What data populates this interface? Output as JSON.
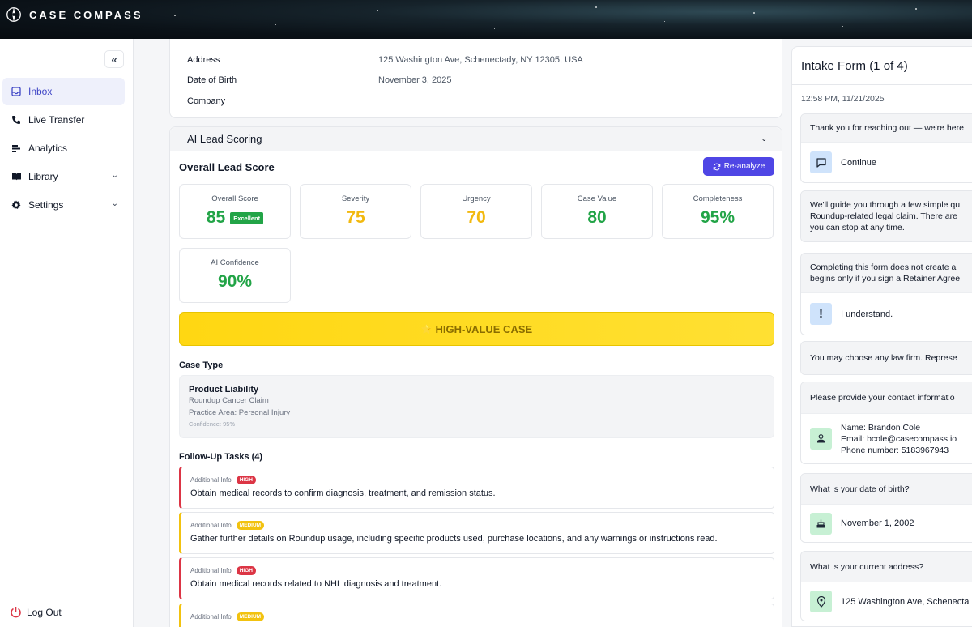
{
  "brand": {
    "name": "CASE COMPASS"
  },
  "sidebar": {
    "collapse_label": "«",
    "items": [
      {
        "label": "Inbox",
        "icon": "inbox-icon",
        "active": true
      },
      {
        "label": "Live Transfer",
        "icon": "phone-icon"
      },
      {
        "label": "Analytics",
        "icon": "analytics-icon"
      },
      {
        "label": "Library",
        "icon": "library-icon",
        "expandable": true
      },
      {
        "label": "Settings",
        "icon": "gear-icon",
        "expandable": true
      }
    ],
    "logout_label": "Log Out"
  },
  "contact": {
    "address_label": "Address",
    "address_value": "125 Washington Ave, Schenectady, NY 12305, USA",
    "dob_label": "Date of Birth",
    "dob_value": "November 3, 2025",
    "company_label": "Company",
    "company_value": ""
  },
  "lead_scoring": {
    "section_title": "AI Lead Scoring",
    "overall_title": "Overall Lead Score",
    "reanalyze_label": "Re-analyze",
    "metrics": [
      {
        "label": "Overall Score",
        "value": "85",
        "badge": "Excellent",
        "color": "#22a447"
      },
      {
        "label": "Severity",
        "value": "75",
        "color": "#f2b90f"
      },
      {
        "label": "Urgency",
        "value": "70",
        "color": "#f2b90f"
      },
      {
        "label": "Case Value",
        "value": "80",
        "color": "#22a447"
      },
      {
        "label": "Completeness",
        "value": "95%",
        "color": "#22a447"
      },
      {
        "label": "AI Confidence",
        "value": "90%",
        "color": "#22a447"
      }
    ],
    "banner_icon": "⭐",
    "banner_text": "HIGH-VALUE CASE",
    "case_type_title": "Case Type",
    "case_type": {
      "name": "Product Liability",
      "subtitle": "Roundup Cancer Claim",
      "practice_area": "Practice Area: Personal Injury",
      "confidence": "Confidence: 95%"
    },
    "tasks_title": "Follow-Up Tasks (4)",
    "tasks": [
      {
        "category": "Additional Info",
        "priority": "HIGH",
        "text": "Obtain medical records to confirm diagnosis, treatment, and remission status."
      },
      {
        "category": "Additional Info",
        "priority": "MEDIUM",
        "text": "Gather further details on Roundup usage, including specific products used, purchase locations, and any warnings or instructions read."
      },
      {
        "category": "Additional Info",
        "priority": "HIGH",
        "text": "Obtain medical records related to NHL diagnosis and treatment."
      },
      {
        "category": "Additional Info",
        "priority": "MEDIUM",
        "text": ""
      }
    ]
  },
  "intake": {
    "title": "Intake Form (1 of 4)",
    "timestamp": "12:58 PM, 11/21/2025",
    "q1": "Thank you for reaching out — we're here",
    "a1": "Continue",
    "q2_line1": "We'll guide you through a few simple qu",
    "q2_line2": "Roundup-related legal claim. There are",
    "q2_line3": "you can stop at any time.",
    "q3_line1": "Completing this form does not create a",
    "q3_line2": "begins only if you sign a Retainer Agree",
    "a3": "I understand.",
    "q4": "You may choose any law firm. Represe",
    "q5": "Please provide your contact informatio",
    "a5_name": "Name: Brandon Cole",
    "a5_email": "Email: bcole@casecompass.io",
    "a5_phone": "Phone number: 5183967943",
    "q6": "What is your date of birth?",
    "a6": "November 1, 2002",
    "q7": "What is your current address?",
    "a7": "125 Washington Ave, Schenecta"
  }
}
